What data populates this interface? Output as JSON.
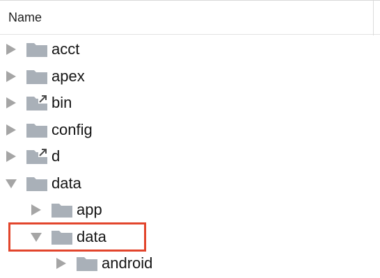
{
  "header": {
    "column_name": "Name"
  },
  "tree": {
    "items": [
      {
        "label": "acct",
        "depth": 0,
        "expanded": false,
        "symlink": false
      },
      {
        "label": "apex",
        "depth": 0,
        "expanded": false,
        "symlink": false
      },
      {
        "label": "bin",
        "depth": 0,
        "expanded": false,
        "symlink": true
      },
      {
        "label": "config",
        "depth": 0,
        "expanded": false,
        "symlink": false
      },
      {
        "label": "d",
        "depth": 0,
        "expanded": false,
        "symlink": true
      },
      {
        "label": "data",
        "depth": 0,
        "expanded": true,
        "symlink": false
      },
      {
        "label": "app",
        "depth": 1,
        "expanded": false,
        "symlink": false
      },
      {
        "label": "data",
        "depth": 1,
        "expanded": true,
        "symlink": false,
        "highlighted": true
      },
      {
        "label": "android",
        "depth": 2,
        "expanded": false,
        "symlink": false
      }
    ]
  },
  "colors": {
    "folder": "#a9b0b8",
    "twisty": "#a5a5a5",
    "highlight": "#e2452c",
    "text": "#151515"
  }
}
